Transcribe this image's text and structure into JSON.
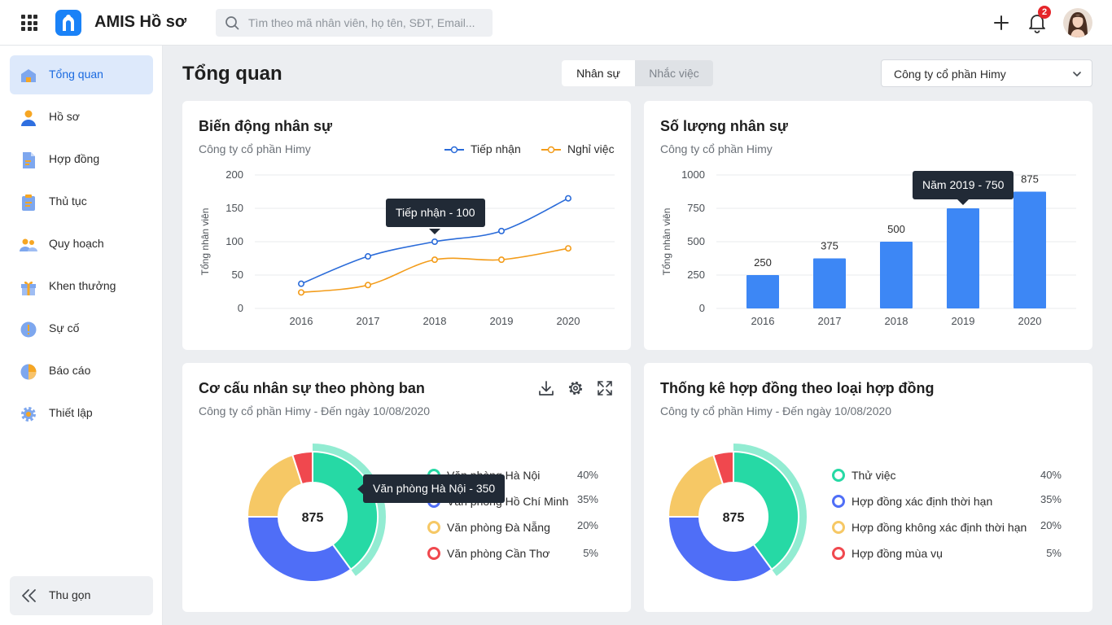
{
  "app": {
    "title": "AMIS Hồ sơ",
    "search_placeholder": "Tìm theo mã nhân viên, họ tên, SĐT, Email...",
    "notification_count": "2"
  },
  "sidebar": {
    "items": [
      {
        "label": "Tổng quan",
        "icon": "home-icon",
        "active": true
      },
      {
        "label": "Hồ sơ",
        "icon": "user-icon"
      },
      {
        "label": "Hợp đồng",
        "icon": "document-icon"
      },
      {
        "label": "Thủ tục",
        "icon": "clipboard-icon"
      },
      {
        "label": "Quy hoạch",
        "icon": "team-icon"
      },
      {
        "label": "Khen thưởng",
        "icon": "gift-icon"
      },
      {
        "label": "Sự cố",
        "icon": "alert-icon"
      },
      {
        "label": "Báo cáo",
        "icon": "pie-icon"
      },
      {
        "label": "Thiết lập",
        "icon": "gear-icon"
      }
    ],
    "collapse_label": "Thu gọn"
  },
  "page": {
    "title": "Tổng quan",
    "tabs": [
      {
        "label": "Nhân sự",
        "active": true
      },
      {
        "label": "Nhắc việc"
      }
    ],
    "company": "Công ty cổ phần Himy"
  },
  "cards": {
    "movement": {
      "title": "Biến động nhân sự",
      "subtitle": "Công ty cổ phần Himy",
      "tooltip": "Tiếp nhận - 100",
      "legend": [
        "Tiếp nhận",
        "Nghỉ việc"
      ]
    },
    "headcount": {
      "title": "Số lượng nhân sự",
      "subtitle": "Công ty cổ phần Himy",
      "tooltip": "Năm 2019 - 750"
    },
    "departments": {
      "title": "Cơ cấu nhân sự theo phòng ban",
      "subtitle": "Công ty cổ phần Himy - Đến ngày 10/08/2020",
      "center": "875",
      "tooltip": "Văn phòng Hà Nội - 350"
    },
    "contracts": {
      "title": "Thống kê hợp đồng theo loại hợp đồng",
      "subtitle": "Công ty cổ phần Himy - Đến ngày 10/08/2020",
      "center": "875"
    }
  },
  "chart_data": [
    {
      "type": "line",
      "categories": [
        "2016",
        "2017",
        "2018",
        "2019",
        "2020"
      ],
      "series": [
        {
          "name": "Tiếp nhận",
          "values": [
            37,
            78,
            100,
            116,
            165
          ],
          "color": "#2a6bd9"
        },
        {
          "name": "Nghỉ việc",
          "values": [
            24,
            35,
            73,
            73,
            90
          ],
          "color": "#f39c1a"
        }
      ],
      "ylabel": "Tổng nhân viên",
      "yticks": [
        0,
        50,
        100,
        150,
        200
      ],
      "ylim": [
        0,
        200
      ],
      "grid": true,
      "legend": "top-right"
    },
    {
      "type": "bar",
      "categories": [
        "2016",
        "2017",
        "2018",
        "2019",
        "2020"
      ],
      "values": [
        250,
        375,
        500,
        750,
        875
      ],
      "value_labels": [
        "250",
        "375",
        "500",
        "",
        "875"
      ],
      "ylabel": "Tổng nhân viên",
      "yticks": [
        0,
        250,
        500,
        750,
        1000
      ],
      "ylim": [
        0,
        1000
      ],
      "color": "#3d87f5",
      "grid": true
    },
    {
      "type": "pie",
      "labels": [
        "Văn phòng Hà Nội",
        "Văn phòng Hồ Chí Minh",
        "Văn phòng Đà Nẵng",
        "Văn phòng Cần Thơ"
      ],
      "percents": [
        "40%",
        "35%",
        "20%",
        "5%"
      ],
      "values": [
        40,
        35,
        20,
        5
      ],
      "colors": [
        "#26d9a5",
        "#4f6ef7",
        "#f6c865",
        "#f0484e"
      ],
      "highlight": 0
    },
    {
      "type": "pie",
      "labels": [
        "Thử việc",
        "Hợp đồng xác định thời hạn",
        "Hợp đồng không xác định thời hạn",
        "Hợp đồng mùa vụ"
      ],
      "percents": [
        "40%",
        "35%",
        "20%",
        "5%"
      ],
      "values": [
        40,
        35,
        20,
        5
      ],
      "colors": [
        "#26d9a5",
        "#4f6ef7",
        "#f6c865",
        "#f0484e"
      ],
      "highlight": 0
    }
  ]
}
